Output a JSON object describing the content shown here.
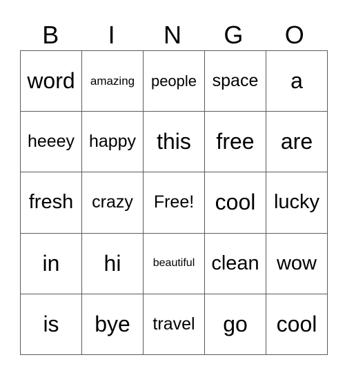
{
  "header": {
    "letters": [
      "B",
      "I",
      "N",
      "G",
      "O"
    ]
  },
  "grid": {
    "rows": [
      [
        "word",
        "amazing",
        "people",
        "space",
        "a"
      ],
      [
        "heeey",
        "happy",
        "this",
        "free",
        "are"
      ],
      [
        "fresh",
        "crazy",
        "Free!",
        "cool",
        "lucky"
      ],
      [
        "in",
        "hi",
        "beautiful",
        "clean",
        "wow"
      ],
      [
        "is",
        "bye",
        "travel",
        "go",
        "cool"
      ]
    ]
  }
}
